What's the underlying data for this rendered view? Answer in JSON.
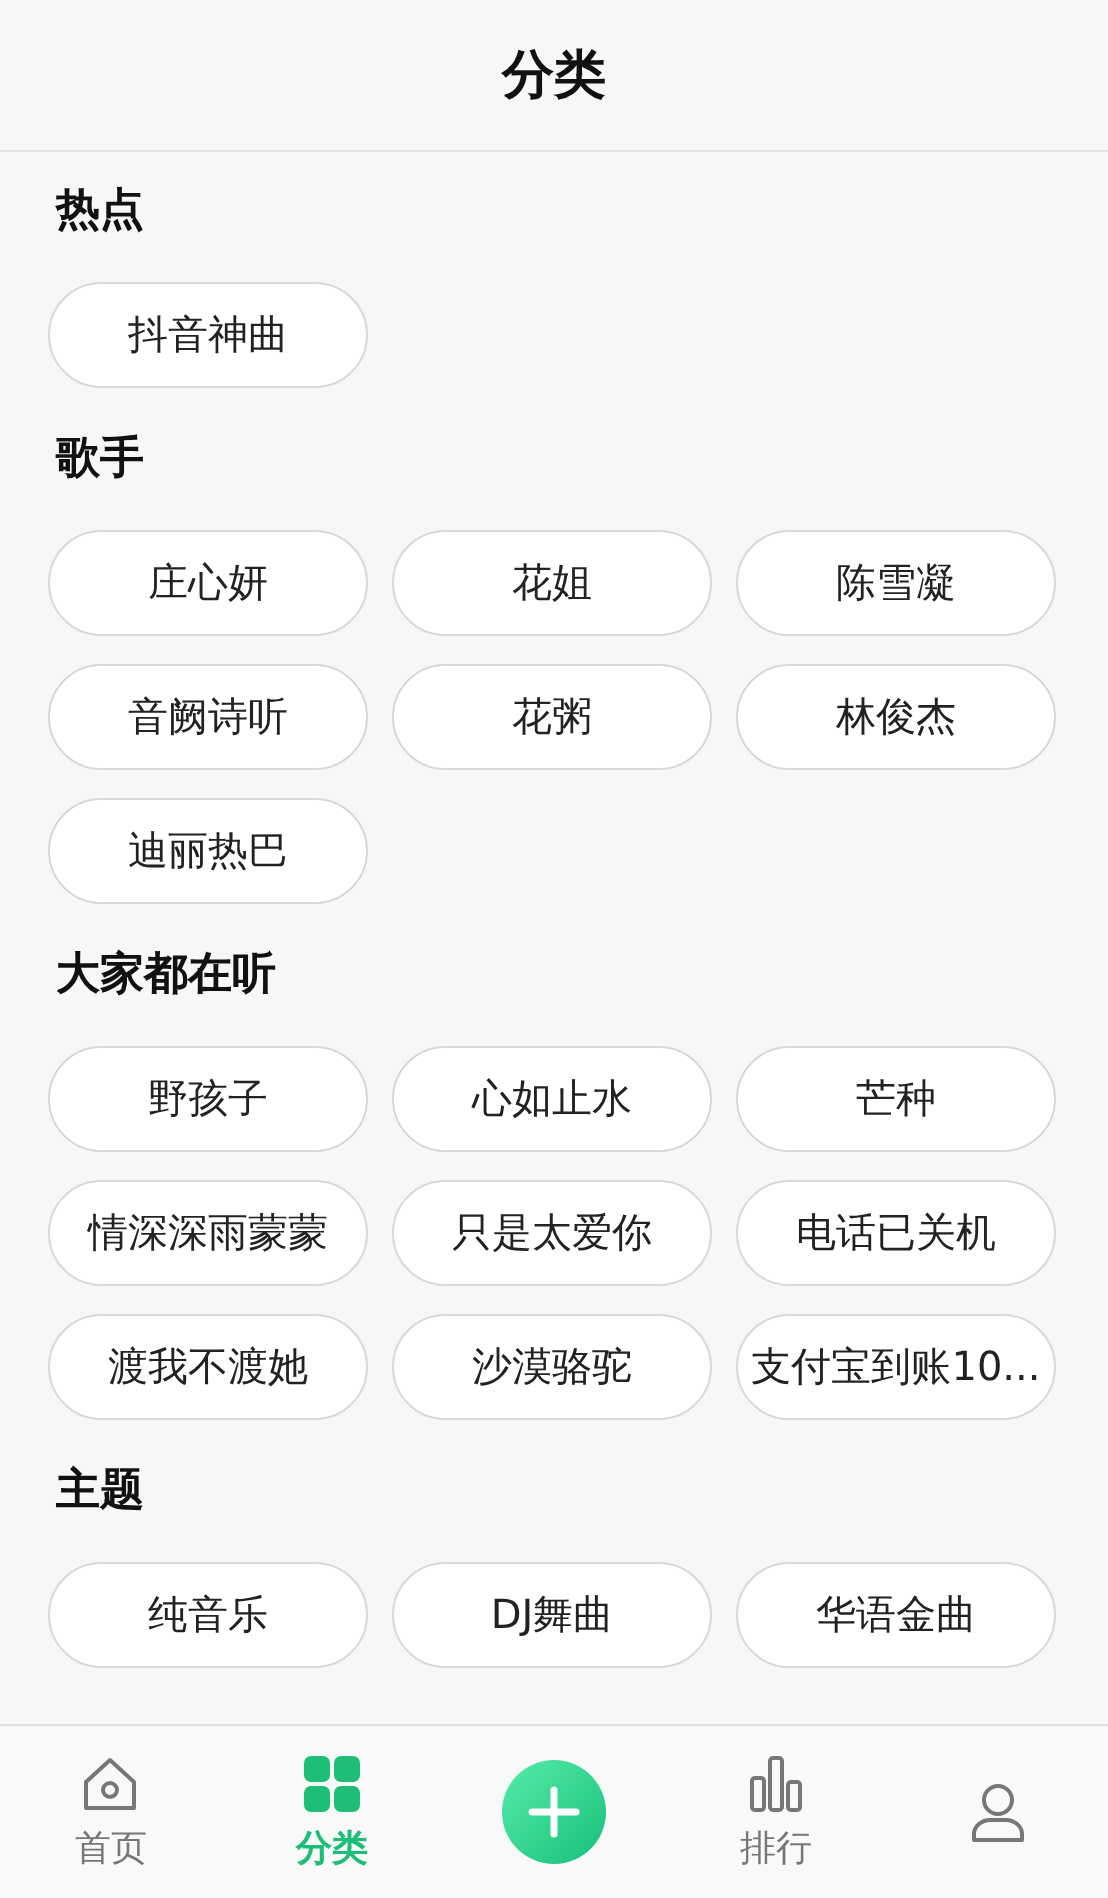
{
  "header": {
    "title": "分类"
  },
  "sections": [
    {
      "title": "热点",
      "tags": [
        "抖音神曲"
      ]
    },
    {
      "title": "歌手",
      "tags": [
        "庄心妍",
        "花姐",
        "陈雪凝",
        "音阙诗听",
        "花粥",
        "林俊杰",
        "迪丽热巴"
      ]
    },
    {
      "title": "大家都在听",
      "tags": [
        "野孩子",
        "心如止水",
        "芒种",
        "情深深雨蒙蒙",
        "只是太爱你",
        "电话已关机",
        "渡我不渡她",
        "沙漠骆驼",
        "支付宝到账10..."
      ]
    },
    {
      "title": "主题",
      "tags": [
        "纯音乐",
        "DJ舞曲",
        "华语金曲"
      ]
    }
  ],
  "tab_bar": [
    {
      "kind": "home",
      "label": "首页",
      "selected": false
    },
    {
      "kind": "grid",
      "label": "分类",
      "selected": true
    },
    {
      "kind": "add"
    },
    {
      "kind": "chart",
      "label": "排行",
      "selected": false
    },
    {
      "kind": "person",
      "selected": false
    }
  ]
}
